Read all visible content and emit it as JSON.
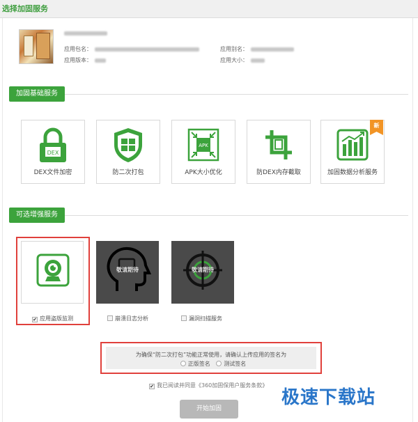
{
  "page": {
    "title": "选择加固服务"
  },
  "app_info": {
    "package_label": "应用包名：",
    "version_label": "应用版本：",
    "alias_label": "应用别名：",
    "size_label": "应用大小："
  },
  "basic_section": {
    "title": "加固基础服务",
    "items": [
      {
        "label": "DEX文件加密",
        "icon": "lock-icon",
        "icon_text": "DEX"
      },
      {
        "label": "防二次打包",
        "icon": "shield-icon"
      },
      {
        "label": "APK大小优化",
        "icon": "apk-compress-icon",
        "icon_text": "APK"
      },
      {
        "label": "防DEX内存截取",
        "icon": "crop-icon"
      },
      {
        "label": "加固数据分析服务",
        "icon": "chart-icon",
        "badge": "新"
      }
    ]
  },
  "optional_section": {
    "title": "可选增强服务",
    "items": [
      {
        "label": "应用盗版监测",
        "icon": "camera-icon",
        "checked": true
      },
      {
        "label": "崩溃日志分析",
        "icon": "head-icon",
        "overlay": "敬请期待",
        "checked": false
      },
      {
        "label": "漏洞扫描服务",
        "icon": "target-icon",
        "overlay": "敬请期待",
        "checked": false
      }
    ]
  },
  "signature_notice": {
    "text": "为确保“防二次打包”功能正常使用，请确认上传应用的签名为",
    "options": [
      "正版签名",
      "测试签名"
    ]
  },
  "agreement": {
    "checked": true,
    "text": "我已阅读并同意《360加固保用户服务条款》"
  },
  "start_button": {
    "label": "开始加固"
  },
  "watermark": {
    "text": "极速下载站"
  },
  "colors": {
    "accent": "#3ca33c",
    "highlight_border": "#e0403b",
    "badge": "#f29425",
    "watermark": "#2a76c9"
  }
}
